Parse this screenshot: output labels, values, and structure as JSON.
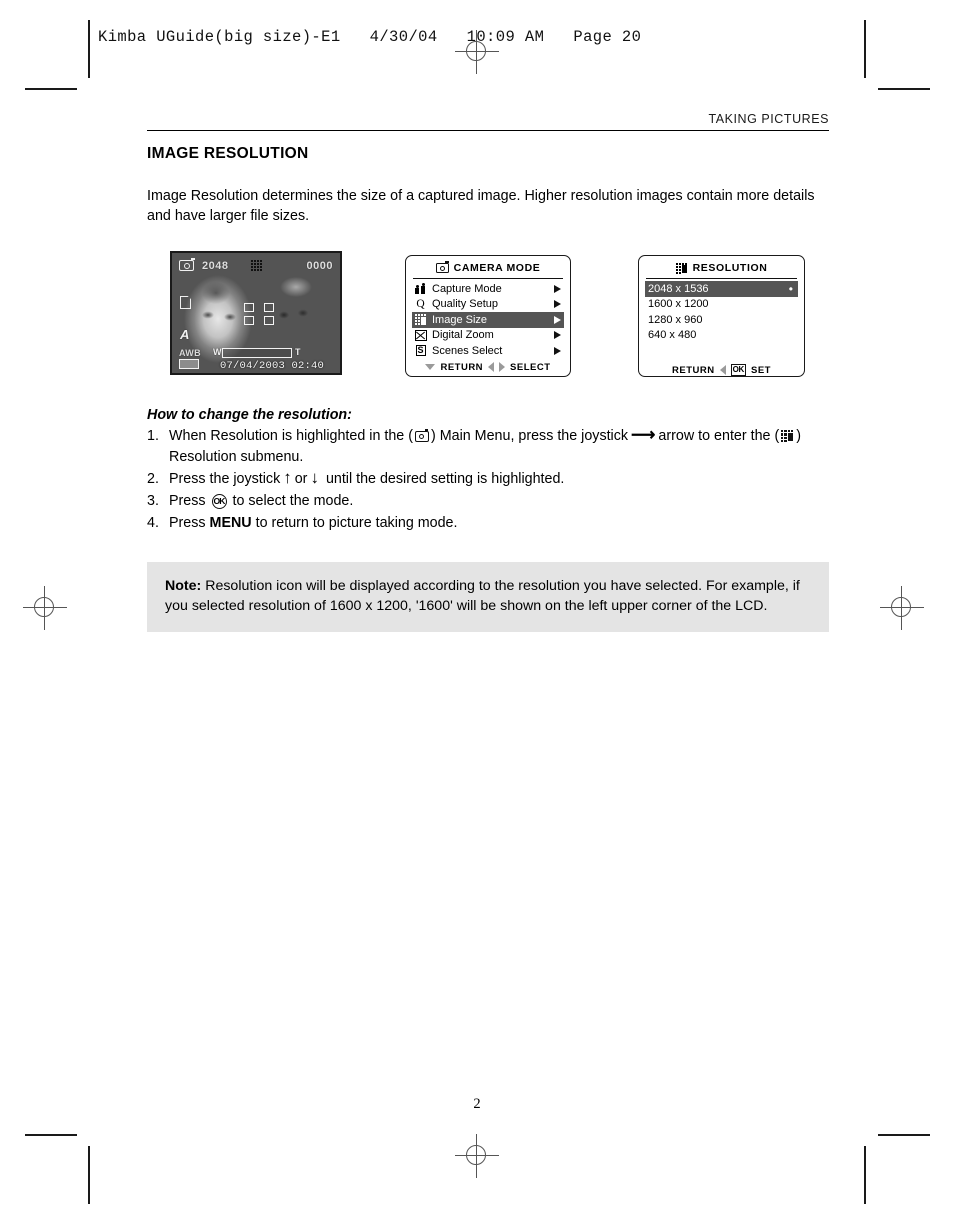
{
  "imprint": "Kimba UGuide(big size)-E1   4/30/04   10:09 AM   Page 20",
  "running_head": "TAKING PICTURES",
  "section_title": "IMAGE RESOLUTION",
  "intro": "Image Resolution determines the size of a captured image.  Higher resolution images contain more details and have larger file sizes.",
  "lcd_preview": {
    "resolution_badge": "2048",
    "frame_counter": "0000",
    "flash_mode": "A",
    "white_balance": "AWB",
    "zoom_wide": "W",
    "zoom_tele": "T",
    "datetime": "07/04/2003  02:40"
  },
  "camera_mode_menu": {
    "title": "CAMERA  MODE",
    "items": [
      {
        "label": "Capture Mode",
        "icon": "people-icon",
        "selected": false
      },
      {
        "label": "Quality Setup",
        "icon": "quality-q-icon",
        "selected": false
      },
      {
        "label": "Image Size",
        "icon": "image-size-grid-icon",
        "selected": true
      },
      {
        "label": "Digital Zoom",
        "icon": "digital-zoom-icon",
        "selected": false
      },
      {
        "label": "Scenes Select",
        "icon": "scenes-s-icon",
        "selected": false
      }
    ],
    "footer": {
      "return": "RETURN",
      "select": "SELECT"
    }
  },
  "resolution_menu": {
    "title": "RESOLUTION",
    "options": [
      {
        "label": "2048 x 1536",
        "selected": true,
        "marker": "•"
      },
      {
        "label": "1600 x 1200",
        "selected": false,
        "marker": ""
      },
      {
        "label": "1280 x 960",
        "selected": false,
        "marker": ""
      },
      {
        "label": "640 x 480",
        "selected": false,
        "marker": ""
      }
    ],
    "footer": {
      "return": "RETURN",
      "ok_key": "OK",
      "set": "SET"
    }
  },
  "howto": {
    "title": "How to change the resolution:",
    "steps": [
      {
        "num": "1.",
        "part_a": "When Resolution is highlighted in the (",
        "part_b": ") Main Menu, press the joystick",
        "part_c": "arrow to enter the (",
        "part_d": ") Resolution submenu."
      },
      {
        "num": "2.",
        "part_a": "Press the joystick",
        "part_b": "or",
        "part_c": "until the desired setting is highlighted."
      },
      {
        "num": "3.",
        "part_a": "Press",
        "part_b": "to select the mode."
      },
      {
        "num": "4.",
        "part_a": "Press",
        "part_b": "MENU",
        "part_c": "to return to picture taking mode."
      }
    ]
  },
  "note": {
    "label": "Note:",
    "text": " Resolution icon will be displayed according to the resolution you have selected. For example, if you selected resolution of 1600 x 1200, '1600'  will be shown on the left upper corner of the LCD."
  },
  "folio": "2",
  "colors": {
    "highlight": "#555555",
    "note_background": "#e4e4e4",
    "rule": "#000000"
  }
}
